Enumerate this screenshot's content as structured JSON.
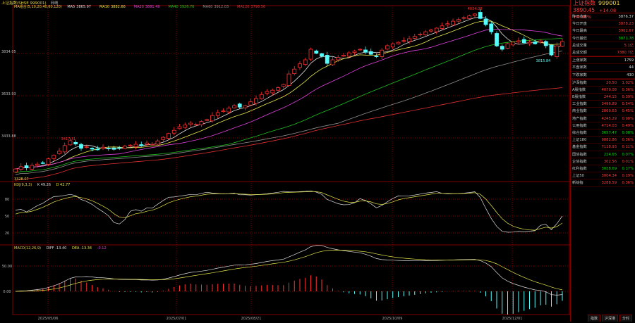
{
  "topbar": {
    "title": "上证指数(SHSE 999001)",
    "period": "日线"
  },
  "ma_legend": {
    "label": "MA组合(5,10,20,40,60,120)",
    "items": [
      {
        "name": "MA5",
        "value": "3865.97",
        "color": "#dddddd"
      },
      {
        "name": "MA10",
        "value": "3882.66",
        "color": "#e8e84a"
      },
      {
        "name": "MA20",
        "value": "3881.49",
        "color": "#e040e0"
      },
      {
        "name": "MA40",
        "value": "3926.76",
        "color": "#20c020"
      },
      {
        "name": "MA60",
        "value": "3912.03",
        "color": "#909090"
      },
      {
        "name": "MA120",
        "value": "3798.56",
        "color": "#e03030"
      }
    ]
  },
  "price_axis": [
    "3834.05",
    "3633.93",
    "3433.88"
  ],
  "price_marks": {
    "high": "4034.08",
    "low": "3815.84",
    "early_high": "3417.31",
    "start_low": "3328.07"
  },
  "kdj_legend": {
    "label": "KDJ(9,3,3)",
    "k": "K 49.26",
    "d": "D 42.77"
  },
  "kdj_axis": [
    "80",
    "50",
    "20"
  ],
  "macd_legend": {
    "label": "MACD(12,26,9)",
    "diff": "DIFF -13.40",
    "dea": "DEA -13.34",
    "macd": "-0.12"
  },
  "macd_axis": [
    "50.00",
    "0.00"
  ],
  "dates": [
    "2025/05/06",
    "2025/07/01",
    "2025/08/21",
    "2025/10/09",
    "2025/12/01"
  ],
  "colors": {
    "up": "#ff3232",
    "down": "#54fcfc",
    "grid": "#800000"
  },
  "chart_data": {
    "type": "candlestick",
    "closes": [
      3287,
      3298,
      3292,
      3304,
      3310,
      3314,
      3335,
      3352,
      3371,
      3398,
      3421,
      3405,
      3385,
      3392,
      3381,
      3378,
      3390,
      3385,
      3380,
      3387,
      3395,
      3400,
      3404,
      3398,
      3410,
      3404,
      3420,
      3437,
      3455,
      3470,
      3487,
      3495,
      3504,
      3498,
      3512,
      3521,
      3540,
      3554,
      3562,
      3575,
      3587,
      3580,
      3587,
      3605,
      3621,
      3640,
      3654,
      3660,
      3672,
      3687,
      3737,
      3760,
      3785,
      3804,
      3854,
      3835,
      3821,
      3787,
      3804,
      3815,
      3826,
      3837,
      3845,
      3854,
      3840,
      3830,
      3821,
      3850,
      3871,
      3880,
      3887,
      3895,
      3904,
      3915,
      3925,
      3937,
      3945,
      3954,
      3965,
      3975,
      3987,
      3995,
      4004,
      4012,
      4021,
      4000,
      3971,
      3937,
      3870,
      3854,
      3881,
      3888,
      3894,
      3885,
      3887,
      3880,
      3894,
      3871,
      3827,
      3870,
      3890.45
    ]
  },
  "panel": {
    "name": "上证指数",
    "code": "999001",
    "price": "3890.45",
    "change": "+14.08",
    "pct": "+0.36%",
    "stats": [
      {
        "label": "昨日收盘",
        "value": "3876.37",
        "c": "wh"
      },
      {
        "label": "今日开盘",
        "value": "3878.23",
        "c": "up"
      },
      {
        "label": "今日最高",
        "value": "3902.67",
        "c": "up"
      },
      {
        "label": "今日最低",
        "value": "3871.78",
        "c": "dn"
      },
      {
        "label": "总成交量",
        "value": "5.1亿",
        "c": "up"
      },
      {
        "label": "总成交额",
        "value": "7380.7亿",
        "c": "up"
      }
    ],
    "breadth": [
      {
        "label": "上涨家数",
        "value": "1759"
      },
      {
        "label": "平盘家数",
        "value": "44"
      },
      {
        "label": "下跌家数",
        "value": "430"
      }
    ],
    "indices": [
      {
        "label": "沪深指数",
        "value": "20.50",
        "pct": "1.02%",
        "c": "up"
      },
      {
        "label": "A股指数",
        "value": "4079.08",
        "pct": "0.36%",
        "c": "up"
      },
      {
        "label": "B股指数",
        "value": "244.15",
        "pct": "0.39%",
        "c": "up"
      },
      {
        "label": "工业指数",
        "value": "3496.89",
        "pct": "0.54%",
        "c": "up"
      },
      {
        "label": "商业指数",
        "value": "2869.63",
        "pct": "0.45%",
        "c": "up"
      },
      {
        "label": "地产指数",
        "value": "4245.29",
        "pct": "0.98%",
        "c": "up"
      },
      {
        "label": "公用指数",
        "value": "4714.03",
        "pct": "0.49%",
        "c": "up"
      },
      {
        "label": "综合指数",
        "value": "3657.47",
        "pct": "0.08%",
        "c": "dn"
      },
      {
        "label": "上证180",
        "value": "9882.86",
        "pct": "0.36%",
        "c": "up"
      },
      {
        "label": "基金指数",
        "value": "7118.93",
        "pct": "0.11%",
        "c": "up"
      },
      {
        "label": "国债指数",
        "value": "224.65",
        "pct": "0.07%",
        "c": "dn"
      },
      {
        "label": "企债指数",
        "value": "302.56",
        "pct": "0.01%",
        "c": "up"
      },
      {
        "label": "红利指数",
        "value": "3028.69",
        "pct": "0.17%",
        "c": "dn"
      },
      {
        "label": "上证50",
        "value": "3004.34",
        "pct": "0.19%",
        "c": "up"
      },
      {
        "label": "新综指",
        "value": "3288.59",
        "pct": "0.36%",
        "c": "up"
      }
    ]
  },
  "tabs": [
    "指数",
    "沪深港",
    "分时"
  ]
}
